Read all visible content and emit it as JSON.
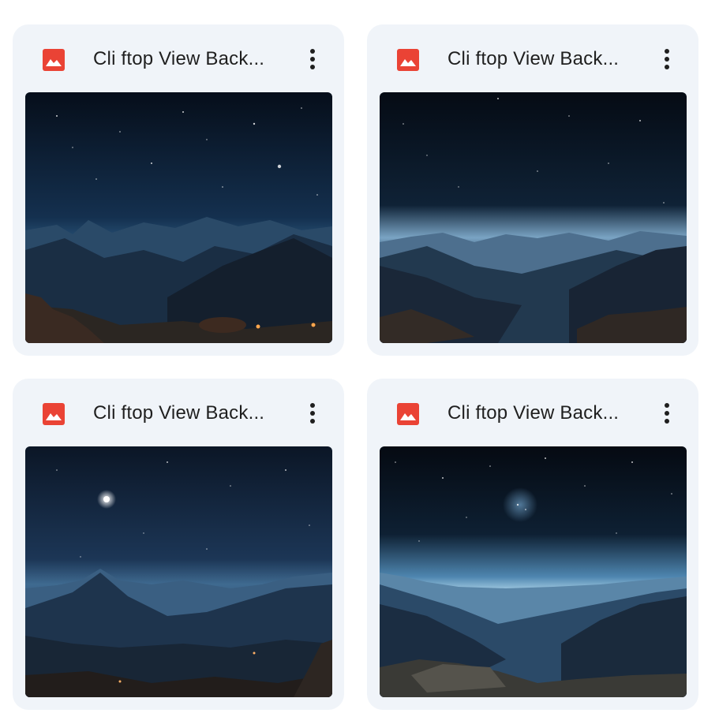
{
  "files": [
    {
      "title": "Cli ftop View Back...",
      "type": "image",
      "icon": "image-file-icon",
      "menu_icon": "more-vert-icon"
    },
    {
      "title": "Cli ftop View Back...",
      "type": "image",
      "icon": "image-file-icon",
      "menu_icon": "more-vert-icon"
    },
    {
      "title": "Cli ftop View Back...",
      "type": "image",
      "icon": "image-file-icon",
      "menu_icon": "more-vert-icon"
    },
    {
      "title": "Cli ftop View Back...",
      "type": "image",
      "icon": "image-file-icon",
      "menu_icon": "more-vert-icon"
    }
  ],
  "colors": {
    "card_bg": "#f0f4f9",
    "icon_red": "#ea4335",
    "text": "#1f1f1f"
  }
}
